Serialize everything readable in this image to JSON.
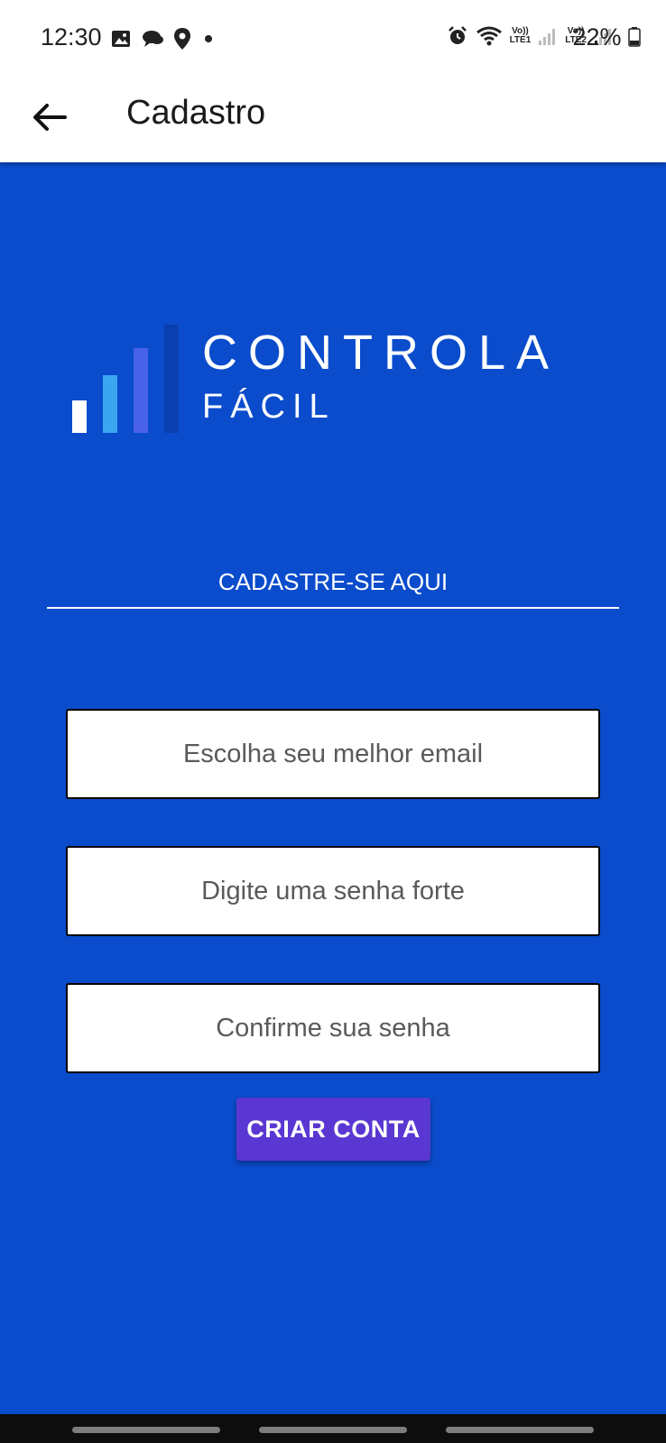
{
  "status_bar": {
    "time": "12:30",
    "battery_percent": "22%",
    "volte1_top": "Vo))",
    "volte1_bottom": "LTE1",
    "volte2_top": "Vo))",
    "volte2_bottom": "LTE2",
    "left_icons": [
      "image-icon",
      "chat-icon",
      "location-icon",
      "dot-icon"
    ],
    "right_icons": [
      "alarm-icon",
      "wifi-icon",
      "signal-icon",
      "signal-icon",
      "battery-icon"
    ]
  },
  "app_bar": {
    "title": "Cadastro",
    "back_icon": "arrow-left-icon"
  },
  "logo": {
    "line1": "CONTROLA",
    "line2": "FÁCIL",
    "bar_colors": [
      "#ffffff",
      "#3aa6f0",
      "#4a62e8",
      "#0a3fb0"
    ]
  },
  "form": {
    "heading": "CADASTRE-SE AQUI",
    "email_placeholder": "Escolha seu melhor email",
    "password_placeholder": "Digite uma senha forte",
    "confirm_placeholder": "Confirme sua senha",
    "submit_label": "CRIAR CONTA"
  },
  "colors": {
    "background": "#0a4ccc",
    "button": "#5a37d2"
  }
}
